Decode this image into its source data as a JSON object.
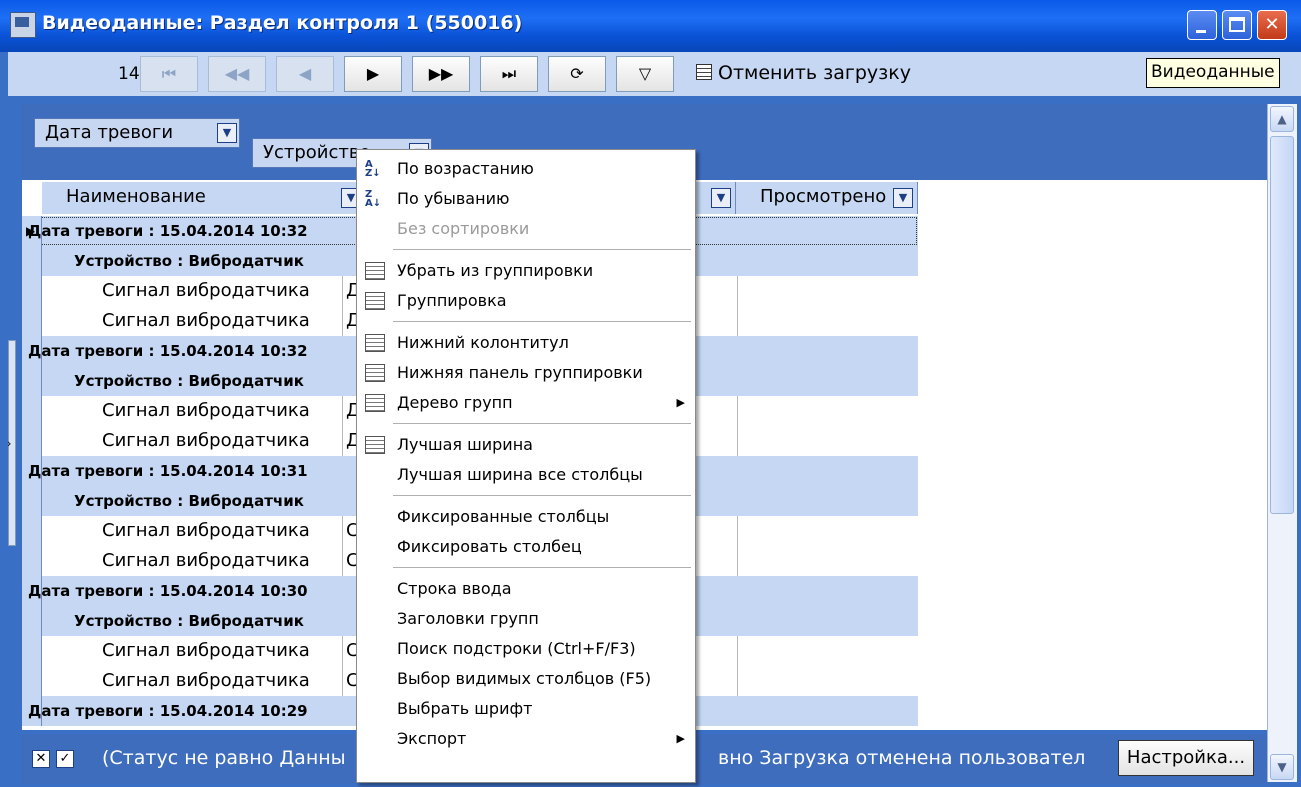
{
  "window": {
    "title": "Видеоданные: Раздел контроля 1 (550016)",
    "tooltip": "Видеоданные"
  },
  "toolbar": {
    "count": "14",
    "nav_buttons": [
      {
        "icon": "first-record-icon",
        "glyph": "⏮",
        "enabled": false
      },
      {
        "icon": "prev-page-icon",
        "glyph": "◀◀",
        "enabled": false
      },
      {
        "icon": "prev-record-icon",
        "glyph": "◀",
        "enabled": false
      },
      {
        "icon": "next-record-icon",
        "glyph": "▶",
        "enabled": true
      },
      {
        "icon": "next-page-icon",
        "glyph": "▶▶",
        "enabled": true
      },
      {
        "icon": "last-record-icon",
        "glyph": "⏭",
        "enabled": true
      },
      {
        "icon": "refresh-icon",
        "glyph": "⟳",
        "enabled": true
      },
      {
        "icon": "filter-icon",
        "glyph": "▽",
        "enabled": true
      }
    ],
    "cancel_load": "Отменить загрузку"
  },
  "group_panel": {
    "chips": [
      "Дата тревоги",
      "Устройство"
    ]
  },
  "grid": {
    "columns": [
      "Наименование",
      "Просмотрено"
    ],
    "rows": [
      {
        "type": "group",
        "level": 0,
        "text": "Дата тревоги : 15.04.2014 10:32"
      },
      {
        "type": "group",
        "level": 1,
        "text": "Устройство : Вибродатчик"
      },
      {
        "type": "data",
        "text": "Сигнал вибродатчика",
        "cell2": "Д"
      },
      {
        "type": "data",
        "text": "Сигнал вибродатчика",
        "cell2": "Д"
      },
      {
        "type": "group",
        "level": 0,
        "text": "Дата тревоги : 15.04.2014 10:32"
      },
      {
        "type": "group",
        "level": 1,
        "text": "Устройство : Вибродатчик"
      },
      {
        "type": "data",
        "text": "Сигнал вибродатчика",
        "cell2": "Д"
      },
      {
        "type": "data",
        "text": "Сигнал вибродатчика",
        "cell2": "Д"
      },
      {
        "type": "group",
        "level": 0,
        "text": "Дата тревоги : 15.04.2014 10:31"
      },
      {
        "type": "group",
        "level": 1,
        "text": "Устройство : Вибродатчик"
      },
      {
        "type": "data",
        "text": "Сигнал вибродатчика",
        "cell2": "С"
      },
      {
        "type": "data",
        "text": "Сигнал вибродатчика",
        "cell2": "С"
      },
      {
        "type": "group",
        "level": 0,
        "text": "Дата тревоги : 15.04.2014 10:30"
      },
      {
        "type": "group",
        "level": 1,
        "text": "Устройство : Вибродатчик"
      },
      {
        "type": "data",
        "text": "Сигнал вибродатчика",
        "cell2": "С"
      },
      {
        "type": "data",
        "text": "Сигнал вибродатчика",
        "cell2": "С"
      },
      {
        "type": "group",
        "level": 0,
        "text": "Дата тревоги : 15.04.2014 10:29"
      }
    ]
  },
  "filter_bar": {
    "text_left": "(Статус не равно Данны",
    "text_right": "вно Загрузка отменена пользовател",
    "settings_button": "Настройка..."
  },
  "context_menu": {
    "items": [
      {
        "label": "По возрастанию",
        "icon": "sort-ascending-icon",
        "enabled": true
      },
      {
        "label": "По убыванию",
        "icon": "sort-descending-icon",
        "enabled": true
      },
      {
        "label": "Без сортировки",
        "enabled": false
      },
      {
        "separator": true
      },
      {
        "label": "Убрать из группировки",
        "icon": "ungroup-icon",
        "enabled": true
      },
      {
        "label": "Группировка",
        "icon": "grouping-icon",
        "enabled": true
      },
      {
        "separator": true
      },
      {
        "label": "Нижний колонтитул",
        "icon": "footer-icon",
        "enabled": true
      },
      {
        "label": "Нижняя панель группировки",
        "icon": "group-footer-icon",
        "enabled": true
      },
      {
        "label": "Дерево групп",
        "icon": "group-tree-icon",
        "enabled": true,
        "submenu": true
      },
      {
        "separator": true
      },
      {
        "label": "Лучшая ширина",
        "icon": "best-fit-icon",
        "enabled": true
      },
      {
        "label": "Лучшая ширина все столбцы",
        "enabled": true
      },
      {
        "separator": true
      },
      {
        "label": "Фиксированные столбцы",
        "enabled": true
      },
      {
        "label": "Фиксировать столбец",
        "enabled": true
      },
      {
        "separator": true
      },
      {
        "label": "Строка ввода",
        "enabled": true
      },
      {
        "label": "Заголовки групп",
        "enabled": true
      },
      {
        "label": "Поиск подстроки (Ctrl+F/F3)",
        "enabled": true
      },
      {
        "label": "Выбор видимых столбцов (F5)",
        "enabled": true
      },
      {
        "label": "Выбрать шрифт",
        "enabled": true
      },
      {
        "label": "Экспорт",
        "enabled": true,
        "submenu": true
      }
    ]
  }
}
